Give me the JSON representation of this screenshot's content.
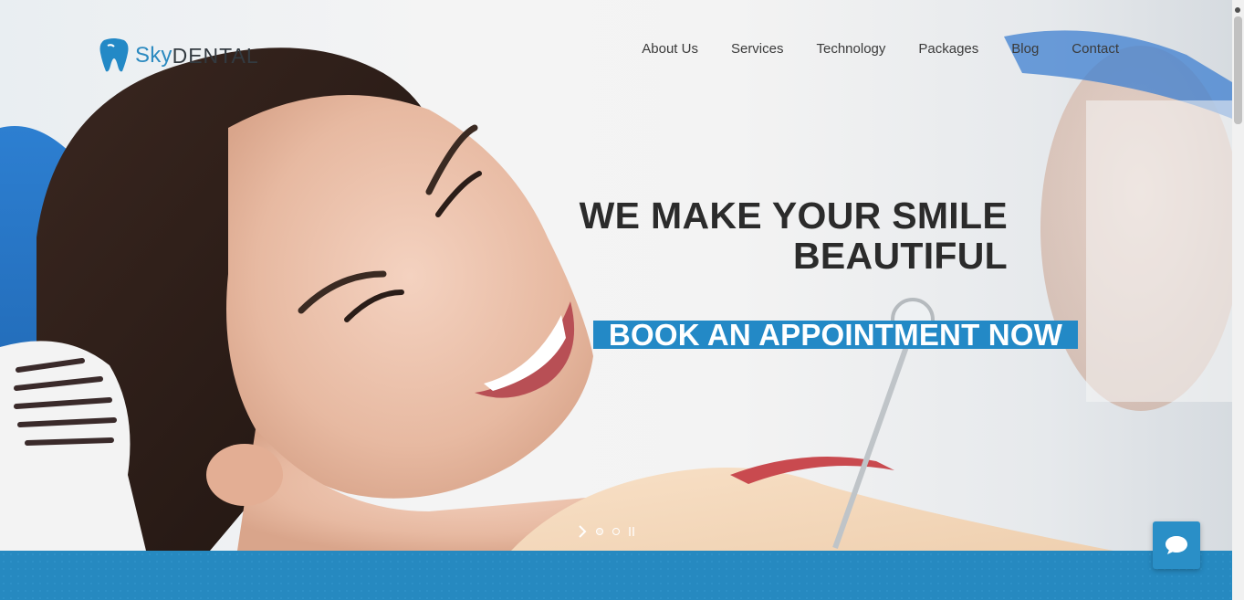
{
  "brand": {
    "name_part1": "Sky",
    "name_part2": "DENTAL",
    "primary_color": "#2389c6",
    "dark_color": "#2b2b2b"
  },
  "nav": {
    "items": [
      {
        "label": "About Us"
      },
      {
        "label": "Services"
      },
      {
        "label": "Technology"
      },
      {
        "label": "Packages"
      },
      {
        "label": "Blog"
      },
      {
        "label": "Contact"
      }
    ]
  },
  "hero": {
    "headline_line1": "WE MAKE YOUR SMILE",
    "headline_line2": "BEAUTIFUL",
    "cta_label": "BOOK AN APPOINTMENT NOW",
    "slides_total": 2,
    "active_slide": 1
  },
  "icons": {
    "logo": "tooth-icon",
    "slider_next": "chevron-right-icon",
    "slider_pause": "pause-icon",
    "chat": "chat-bubble-icon"
  }
}
